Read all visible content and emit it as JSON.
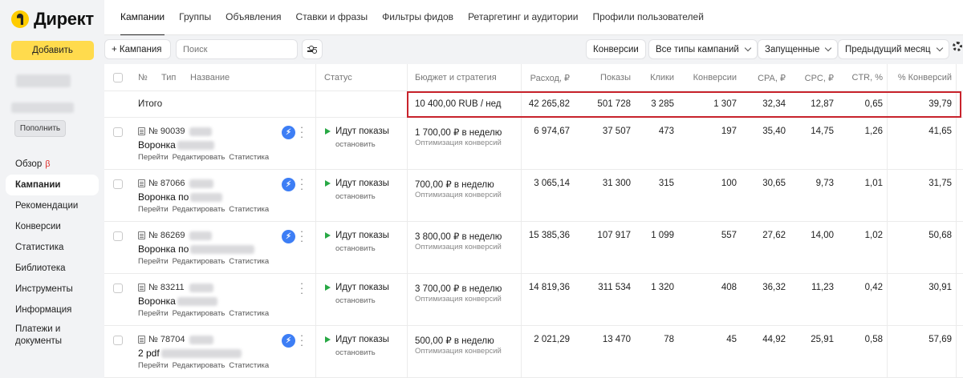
{
  "app": {
    "logo_text": "Директ"
  },
  "sidebar": {
    "add_label": "Добавить",
    "fill_label": "Пополнить",
    "beta_mark": "β",
    "items": [
      {
        "label": "Обзор"
      },
      {
        "label": "Кампании",
        "active": true
      },
      {
        "label": "Рекомендации"
      },
      {
        "label": "Конверсии"
      },
      {
        "label": "Статистика"
      },
      {
        "label": "Библиотека"
      },
      {
        "label": "Инструменты"
      },
      {
        "label": "Информация"
      },
      {
        "label": "Платежи и документы"
      }
    ]
  },
  "tabs": [
    {
      "label": "Кампании",
      "active": true
    },
    {
      "label": "Группы"
    },
    {
      "label": "Объявления"
    },
    {
      "label": "Ставки и фразы"
    },
    {
      "label": "Фильтры фидов"
    },
    {
      "label": "Ретаргетинг и аудитории"
    },
    {
      "label": "Профили пользователей"
    }
  ],
  "toolbar": {
    "add_campaign": "+ Кампания",
    "search_placeholder": "Поиск",
    "conversions": "Конверсии",
    "campaign_types": "Все типы кампаний",
    "state": "Запущенные",
    "period": "Предыдущий месяц"
  },
  "table": {
    "headers": {
      "num": "№",
      "type": "Тип",
      "name": "Название",
      "status": "Статус",
      "budget": "Бюджет и стратегия",
      "cost": "Расход, ₽",
      "impressions": "Показы",
      "clicks": "Клики",
      "conversions": "Конверсии",
      "cpa": "CPA, ₽",
      "cpc": "CPC, ₽",
      "ctr": "CTR, %",
      "conv_rate": "% Конверсий"
    },
    "total": {
      "label": "Итого",
      "budget": "10 400,00 RUB / нед",
      "cost": "42 265,82",
      "impressions": "501 728",
      "clicks": "3 285",
      "conversions": "1 307",
      "cpa": "32,34",
      "cpc": "12,87",
      "ctr": "0,65",
      "conv_rate": "39,79"
    },
    "links": {
      "go": "Перейти",
      "edit": "Редактировать",
      "stats": "Статистика"
    },
    "status_text": "Идут показы",
    "stop_text": "остановить",
    "strategy_text": "Оптимизация конверсий",
    "rows": [
      {
        "id": "№ 90039",
        "name": "Воронка",
        "budget": "1 700,00 ₽ в неделю",
        "cost": "6 974,67",
        "impressions": "37 507",
        "clicks": "473",
        "conversions": "197",
        "cpa": "35,40",
        "cpc": "14,75",
        "ctr": "1,26",
        "conv_rate": "41,65",
        "bolt": true
      },
      {
        "id": "№ 87066",
        "name": "Воронка по",
        "budget": "700,00 ₽ в неделю",
        "cost": "3 065,14",
        "impressions": "31 300",
        "clicks": "315",
        "conversions": "100",
        "cpa": "30,65",
        "cpc": "9,73",
        "ctr": "1,01",
        "conv_rate": "31,75",
        "bolt": true
      },
      {
        "id": "№ 86269",
        "name": "Воронка по",
        "budget": "3 800,00 ₽ в неделю",
        "cost": "15 385,36",
        "impressions": "107 917",
        "clicks": "1 099",
        "conversions": "557",
        "cpa": "27,62",
        "cpc": "14,00",
        "ctr": "1,02",
        "conv_rate": "50,68",
        "bolt": true
      },
      {
        "id": "№ 83211",
        "name": "Воронка",
        "budget": "3 700,00 ₽ в неделю",
        "cost": "14 819,36",
        "impressions": "311 534",
        "clicks": "1 320",
        "conversions": "408",
        "cpa": "36,32",
        "cpc": "11,23",
        "ctr": "0,42",
        "conv_rate": "30,91",
        "bolt": false
      },
      {
        "id": "№ 78704",
        "name": "2 pdf",
        "budget": "500,00 ₽ в неделю",
        "cost": "2 021,29",
        "impressions": "13 470",
        "clicks": "78",
        "conversions": "45",
        "cpa": "44,92",
        "cpc": "25,91",
        "ctr": "0,58",
        "conv_rate": "57,69",
        "bolt": true
      }
    ]
  },
  "colors": {
    "accent_yellow": "#ffdb4d",
    "highlight_red": "#c8232c",
    "play_green": "#27a844",
    "bolt_blue": "#3d7ef5"
  }
}
